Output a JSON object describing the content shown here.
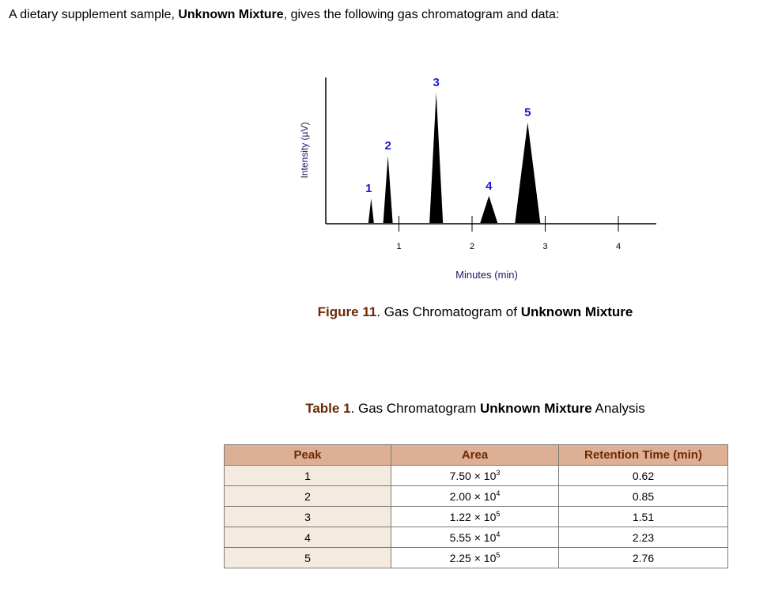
{
  "intro": {
    "before": "A dietary supplement sample, ",
    "bold": "Unknown Mixture",
    "after": ", gives the following gas chromatogram and data:"
  },
  "chart_data": {
    "type": "line",
    "ylabel": "Intensity (µV)",
    "xlabel": "Minutes (min)",
    "xticks": [
      1,
      2,
      3,
      4
    ],
    "xlim": [
      0,
      4.5
    ],
    "ylim": [
      0,
      1.0
    ],
    "peak_color": "#000000",
    "label_color": "#1a1acc",
    "peaks": [
      {
        "label": "1",
        "retention_time": 0.62,
        "relative_height": 0.19
      },
      {
        "label": "2",
        "retention_time": 0.85,
        "relative_height": 0.52
      },
      {
        "label": "3",
        "retention_time": 1.51,
        "relative_height": 1.0
      },
      {
        "label": "4",
        "retention_time": 2.23,
        "relative_height": 0.21
      },
      {
        "label": "5",
        "retention_time": 2.76,
        "relative_height": 0.78
      }
    ]
  },
  "figure_caption": {
    "label": "Figure",
    "number": "11",
    "text": "Gas Chromatogram of",
    "bold": "Unknown Mixture"
  },
  "table_caption": {
    "label": "Table",
    "number": "1",
    "text": "Gas Chromatogram",
    "bold": "Unknown Mixture",
    "after": "Analysis"
  },
  "table": {
    "headers": [
      "Peak",
      "Area",
      "Retention Time (min)"
    ],
    "rows": [
      {
        "peak": "1",
        "area_mantissa": "7.50",
        "area_exp": "3",
        "rt": "0.62"
      },
      {
        "peak": "2",
        "area_mantissa": "2.00",
        "area_exp": "4",
        "rt": "0.85"
      },
      {
        "peak": "3",
        "area_mantissa": "1.22",
        "area_exp": "5",
        "rt": "1.51"
      },
      {
        "peak": "4",
        "area_mantissa": "5.55",
        "area_exp": "4",
        "rt": "2.23"
      },
      {
        "peak": "5",
        "area_mantissa": "2.25",
        "area_exp": "5",
        "rt": "2.76"
      }
    ],
    "times_sign": "× 10"
  }
}
